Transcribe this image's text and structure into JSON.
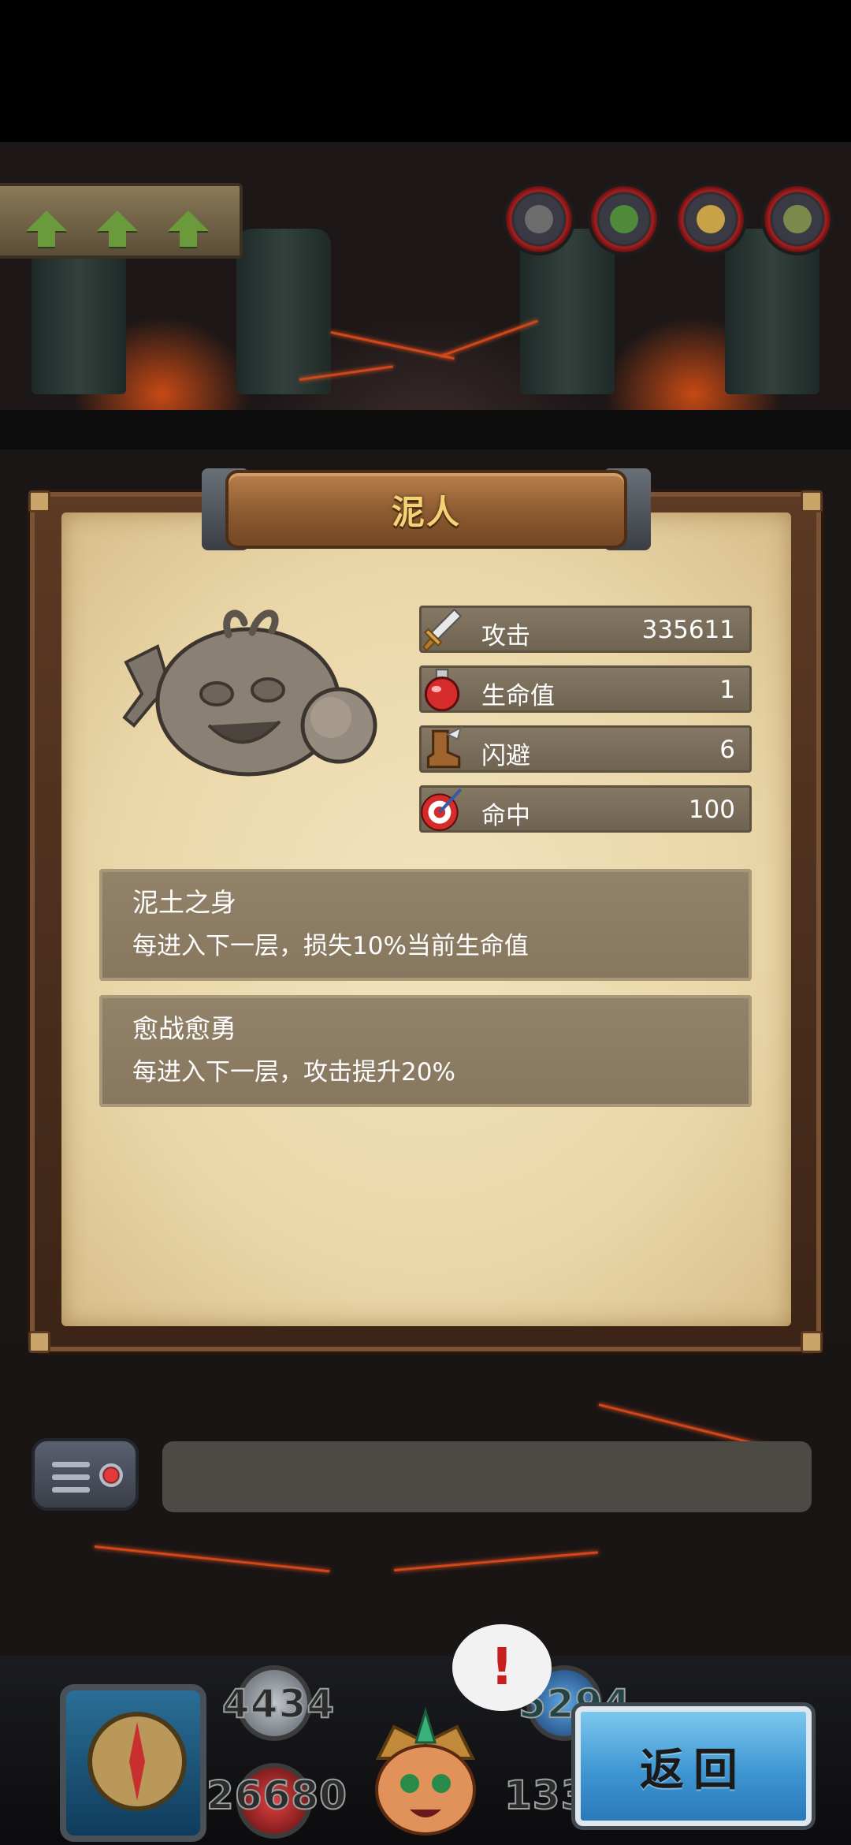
{
  "floor_indicator": {
    "arrows": [
      "up-arrow-icon",
      "up-arrow-icon",
      "up-arrow-icon"
    ]
  },
  "enemy_portraits": [
    "enemy-portrait-1",
    "enemy-portrait-2",
    "enemy-portrait-3",
    "enemy-portrait-4"
  ],
  "monster_card": {
    "title": "泥人",
    "stats": [
      {
        "icon": "sword-icon",
        "label": "攻击",
        "value": "335611"
      },
      {
        "icon": "potion-icon",
        "label": "生命值",
        "value": "1"
      },
      {
        "icon": "boot-icon",
        "label": "闪避",
        "value": "6"
      },
      {
        "icon": "target-icon",
        "label": "命中",
        "value": "100"
      }
    ],
    "skills": [
      {
        "name": "泥土之身",
        "description": "每进入下一层，损失10%当前生命值"
      },
      {
        "name": "愈战愈勇",
        "description": "每进入下一层，攻击提升20%"
      }
    ]
  },
  "chat": {
    "message": ""
  },
  "hud": {
    "attack_value": "4434",
    "defense_value": "5294",
    "hp_value": "26680",
    "gold_value": "133",
    "alert_mark": "!",
    "back_button_label": "返回"
  },
  "colors": {
    "stat_bar": "#7a6e5c",
    "skill_box": "#8b7b62",
    "title_text": "#f4d276",
    "back_button": "#4aa3dc",
    "paper": "#ecdcb1"
  }
}
